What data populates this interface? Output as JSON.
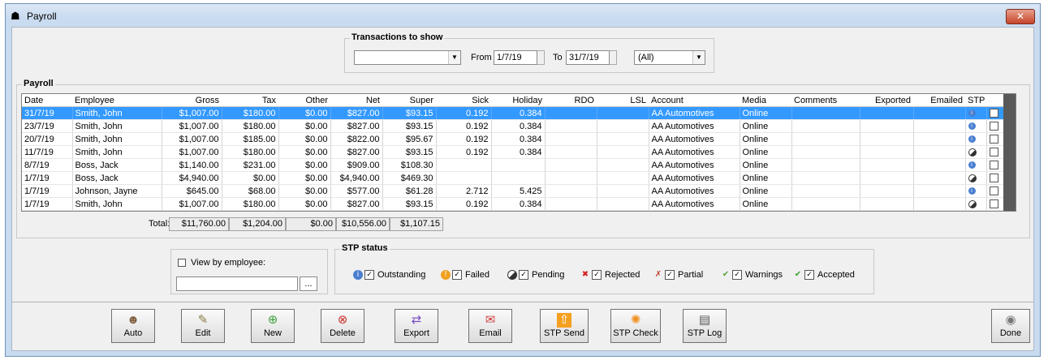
{
  "window": {
    "title": "Payroll",
    "close_label": "✕"
  },
  "transactions": {
    "legend": "Transactions to show",
    "type_value": "",
    "from_label": "From",
    "from_value": "1/7/19",
    "to_label": "To",
    "to_value": "31/7/19",
    "filter_value": "(All)"
  },
  "payroll": {
    "legend": "Payroll",
    "columns": [
      "Date",
      "Employee",
      "Gross",
      "Tax",
      "Other",
      "Net",
      "Super",
      "Sick",
      "Holiday",
      "RDO",
      "LSL",
      "Account",
      "Media",
      "Comments",
      "Exported",
      "Emailed",
      "STP"
    ],
    "rows": [
      {
        "date": "31/7/19",
        "employee": "Smith, John",
        "gross": "$1,007.00",
        "tax": "$180.00",
        "other": "$0.00",
        "net": "$827.00",
        "super": "$93.15",
        "sick": "0.192",
        "holiday": "0.384",
        "rdo": "",
        "lsl": "",
        "account": "AA Automotives",
        "media": "Online",
        "comments": "",
        "exported": "",
        "emailed": "",
        "stp": "outstanding",
        "selected": true
      },
      {
        "date": "23/7/19",
        "employee": "Smith, John",
        "gross": "$1,007.00",
        "tax": "$180.00",
        "other": "$0.00",
        "net": "$827.00",
        "super": "$93.15",
        "sick": "0.192",
        "holiday": "0.384",
        "rdo": "",
        "lsl": "",
        "account": "AA Automotives",
        "media": "Online",
        "comments": "",
        "exported": "",
        "emailed": "",
        "stp": "outstanding",
        "selected": false
      },
      {
        "date": "20/7/19",
        "employee": "Smith, John",
        "gross": "$1,007.00",
        "tax": "$185.00",
        "other": "$0.00",
        "net": "$822.00",
        "super": "$95.67",
        "sick": "0.192",
        "holiday": "0.384",
        "rdo": "",
        "lsl": "",
        "account": "AA Automotives",
        "media": "Online",
        "comments": "",
        "exported": "",
        "emailed": "",
        "stp": "outstanding",
        "selected": false
      },
      {
        "date": "11/7/19",
        "employee": "Smith, John",
        "gross": "$1,007.00",
        "tax": "$180.00",
        "other": "$0.00",
        "net": "$827.00",
        "super": "$93.15",
        "sick": "0.192",
        "holiday": "0.384",
        "rdo": "",
        "lsl": "",
        "account": "AA Automotives",
        "media": "Online",
        "comments": "",
        "exported": "",
        "emailed": "",
        "stp": "pending",
        "selected": false
      },
      {
        "date": "8/7/19",
        "employee": "Boss, Jack",
        "gross": "$1,140.00",
        "tax": "$231.00",
        "other": "$0.00",
        "net": "$909.00",
        "super": "$108.30",
        "sick": "",
        "holiday": "",
        "rdo": "",
        "lsl": "",
        "account": "AA Automotives",
        "media": "Online",
        "comments": "",
        "exported": "",
        "emailed": "",
        "stp": "outstanding",
        "selected": false
      },
      {
        "date": "1/7/19",
        "employee": "Boss, Jack",
        "gross": "$4,940.00",
        "tax": "$0.00",
        "other": "$0.00",
        "net": "$4,940.00",
        "super": "$469.30",
        "sick": "",
        "holiday": "",
        "rdo": "",
        "lsl": "",
        "account": "AA Automotives",
        "media": "Online",
        "comments": "",
        "exported": "",
        "emailed": "",
        "stp": "pending",
        "selected": false
      },
      {
        "date": "1/7/19",
        "employee": "Johnson, Jayne",
        "gross": "$645.00",
        "tax": "$68.00",
        "other": "$0.00",
        "net": "$577.00",
        "super": "$61.28",
        "sick": "2.712",
        "holiday": "5.425",
        "rdo": "",
        "lsl": "",
        "account": "AA Automotives",
        "media": "Online",
        "comments": "",
        "exported": "",
        "emailed": "",
        "stp": "outstanding",
        "selected": false
      },
      {
        "date": "1/7/19",
        "employee": "Smith, John",
        "gross": "$1,007.00",
        "tax": "$180.00",
        "other": "$0.00",
        "net": "$827.00",
        "super": "$93.15",
        "sick": "0.192",
        "holiday": "0.384",
        "rdo": "",
        "lsl": "",
        "account": "AA Automotives",
        "media": "Online",
        "comments": "",
        "exported": "",
        "emailed": "",
        "stp": "pending",
        "selected": false
      }
    ],
    "totals_label": "Total:",
    "totals": {
      "gross": "$11,760.00",
      "tax": "$1,204.00",
      "other": "$0.00",
      "net": "$10,556.00",
      "super": "$1,107.15"
    }
  },
  "view_by_employee": {
    "label": "View by employee:",
    "value": "",
    "browse_label": "..."
  },
  "stp_status": {
    "legend": "STP status",
    "items": [
      {
        "label": "Outstanding",
        "icon": "info-circle-icon"
      },
      {
        "label": "Failed",
        "icon": "warning-circle-icon"
      },
      {
        "label": "Pending",
        "icon": "half-circle-icon"
      },
      {
        "label": "Rejected",
        "icon": "red-x-icon"
      },
      {
        "label": "Partial",
        "icon": "partial-icon"
      },
      {
        "label": "Warnings",
        "icon": "warning-check-icon"
      },
      {
        "label": "Accepted",
        "icon": "green-check-icon"
      }
    ]
  },
  "toolbar": {
    "buttons": [
      {
        "label": "Auto",
        "icon": "auto-users-icon"
      },
      {
        "label": "Edit",
        "icon": "edit-icon"
      },
      {
        "label": "New",
        "icon": "new-icon"
      },
      {
        "label": "Delete",
        "icon": "delete-icon"
      },
      {
        "label": "Export",
        "icon": "export-icon"
      },
      {
        "label": "Email",
        "icon": "email-icon"
      },
      {
        "label": "STP Send",
        "icon": "upload-icon"
      },
      {
        "label": "STP Check",
        "icon": "spinner-icon"
      },
      {
        "label": "STP Log",
        "icon": "log-icon"
      }
    ],
    "done_label": "Done"
  },
  "colors": {
    "selection": "#3399ff",
    "accent_close": "#c7442a"
  }
}
